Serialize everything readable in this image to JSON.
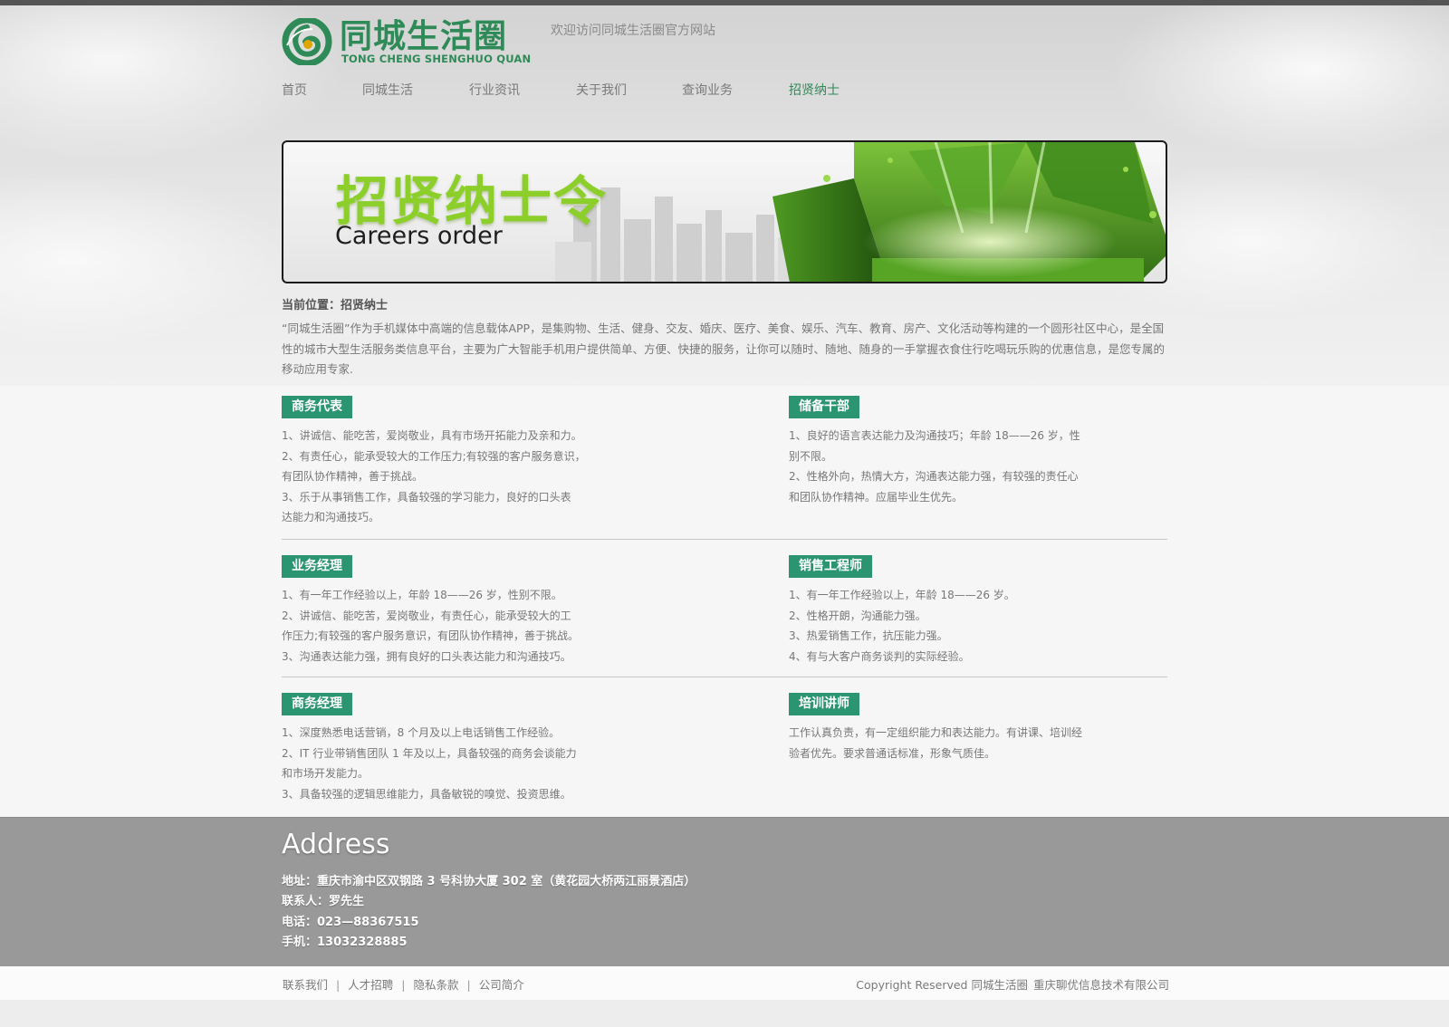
{
  "header": {
    "logo_cn": "同城生活圈",
    "logo_en": "TONG CHENG SHENGHUO QUAN",
    "welcome": "欢迎访问同城生活圈官方网站"
  },
  "nav": {
    "items": [
      "首页",
      "同城生活",
      "行业资讯",
      "关于我们",
      "查询业务",
      "招贤纳士"
    ],
    "active": "招贤纳士"
  },
  "banner": {
    "title_cn": "招贤纳士令",
    "title_en": "Careers order"
  },
  "breadcrumb": "当前位置：招贤纳士",
  "intro": "“同城生活圈”作为手机媒体中高端的信息载体APP，是集购物、生活、健身、交友、婚庆、医疗、美食、娱乐、汽车、教育、房产、文化活动等构建的一个圆形社区中心，是全国性的城市大型生活服务类信息平台，主要为广大智能手机用户提供简单、方便、快捷的服务，让你可以随时、随地、随身的一手掌握衣食住行吃喝玩乐购的优惠信息，是您专属的移动应用专家.",
  "jobs": [
    {
      "title": "商务代表",
      "lines": [
        "1、讲诚信、能吃苦，爱岗敬业，具有市场开拓能力及亲和力。",
        "2、有责任心，能承受较大的工作压力;有较强的客户服务意识，",
        "有团队协作精神，善于挑战。",
        "3、乐于从事销售工作，具备较强的学习能力，良好的口头表",
        "达能力和沟通技巧。"
      ]
    },
    {
      "title": "储备干部",
      "lines": [
        "1、良好的语言表达能力及沟通技巧；年龄 18——26 岁，性",
        "别不限。",
        "2、性格外向，热情大方，沟通表达能力强，有较强的责任心",
        "和团队协作精神。应届毕业生优先。"
      ]
    },
    {
      "title": "业务经理",
      "lines": [
        "1、有一年工作经验以上，年龄 18——26 岁，性别不限。",
        "2、讲诚信、能吃苦，爱岗敬业，有责任心，能承受较大的工",
        "作压力;有较强的客户服务意识，有团队协作精神，善于挑战。",
        "3、沟通表达能力强，拥有良好的口头表达能力和沟通技巧。"
      ]
    },
    {
      "title": "销售工程师",
      "lines": [
        "1、有一年工作经验以上，年龄 18——26 岁。",
        "2、性格开朗，沟通能力强。",
        "3、热爱销售工作，抗压能力强。",
        "4、有与大客户商务谈判的实际经验。"
      ]
    },
    {
      "title": "商务经理",
      "lines": [
        "1、深度熟悉电话营销，8 个月及以上电话销售工作经验。",
        "2、IT 行业带销售团队 1 年及以上，具备较强的商务会谈能力",
        "和市场开发能力。",
        "3、具备较强的逻辑思维能力，具备敏锐的嗅觉、投资思维。"
      ]
    },
    {
      "title": "培训讲师",
      "lines": [
        "工作认真负责，有一定组织能力和表达能力。有讲课、培训经",
        "验者优先。要求普通话标准，形象气质佳。"
      ]
    }
  ],
  "address": {
    "title": "Address",
    "lines": [
      "地址：重庆市渝中区双钢路 3 号科协大厦 302 室（黄花园大桥两江丽景酒店）",
      "联系人：罗先生",
      "电话：023—88367515",
      "手机：13032328885"
    ]
  },
  "footer": {
    "links": [
      "联系我们",
      "人才招聘",
      "隐私条款",
      "公司简介"
    ],
    "copyright": "Copyright Reserved 同城生活圈",
    "company": "重庆聊优信息技术有限公司"
  },
  "colors": {
    "brand_green": "#2e8b57",
    "tag_green": "#2b9470",
    "address_bg": "#999999"
  }
}
